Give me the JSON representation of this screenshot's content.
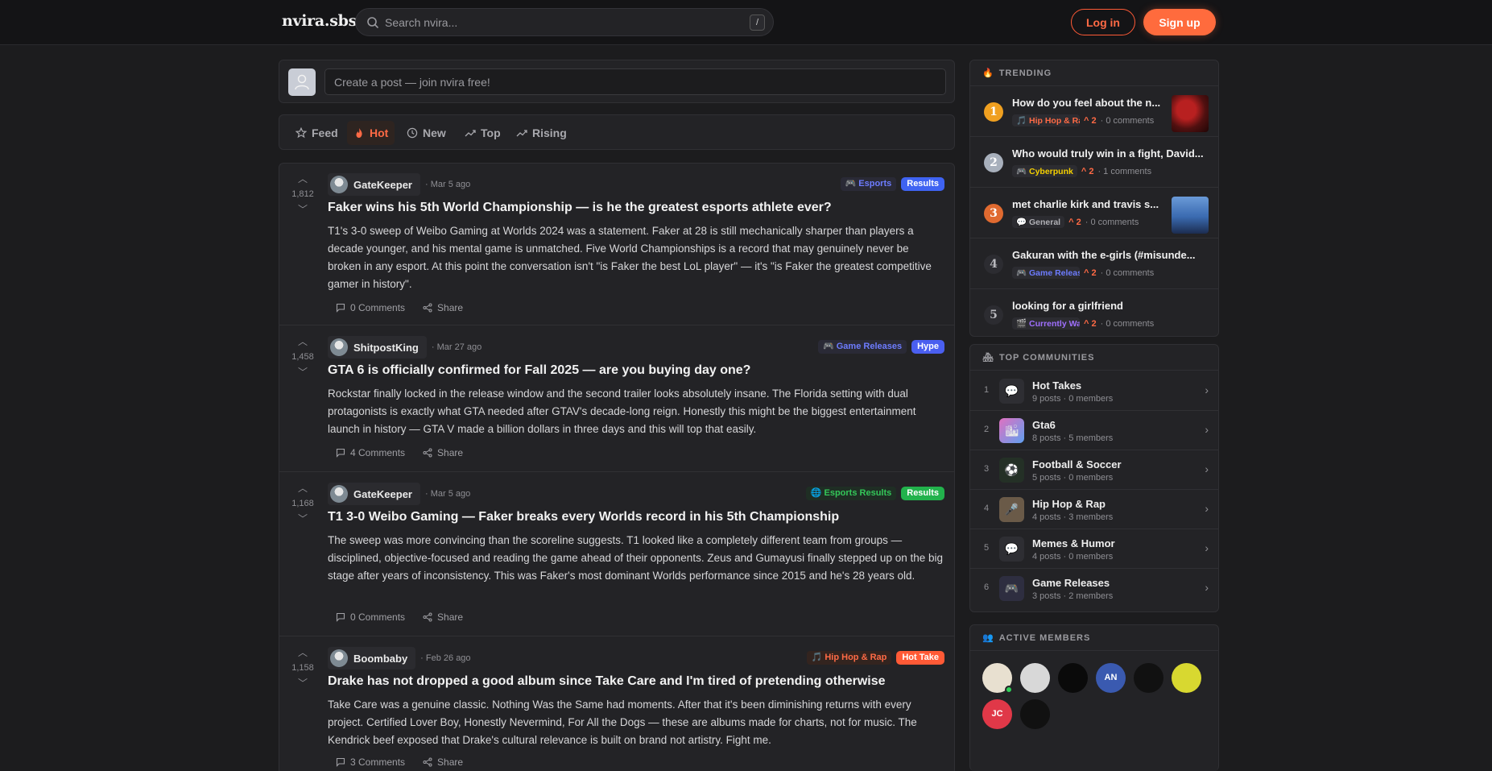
{
  "header": {
    "logo": "nvira.sbs",
    "search_placeholder": "Search nvira...",
    "search_shortcut": "/",
    "login_label": "Log in",
    "signup_label": "Sign up"
  },
  "create_post": {
    "placeholder": "Create a post — join nvira free!"
  },
  "tabs": [
    {
      "label": "Feed",
      "icon": "star-icon",
      "active": false
    },
    {
      "label": "Hot",
      "icon": "flame-icon",
      "active": true
    },
    {
      "label": "New",
      "icon": "clock-icon",
      "active": false
    },
    {
      "label": "Top",
      "icon": "trend-icon",
      "active": false
    },
    {
      "label": "Rising",
      "icon": "rising-icon",
      "active": false
    }
  ],
  "posts": [
    {
      "votes": "1,812",
      "author": "GateKeeper",
      "time": "· Mar 5 ago",
      "category": "🎮 Esports",
      "category_color": "#6d7cff",
      "flair": "Results",
      "flair_color": "#3f63f2",
      "title": "Faker wins his 5th World Championship — is he the greatest esports athlete ever?",
      "body": "T1's 3-0 sweep of Weibo Gaming at Worlds 2024 was a statement. Faker at 28 is still mechanically sharper than players a decade younger, and his mental game is unmatched. Five World Championships is a record that may genuinely never be broken in any esport. At this point the conversation isn't \"is Faker the best LoL player\" — it's \"is Faker the greatest competitive gamer in history\".",
      "comments": "0 Comments",
      "share": "Share"
    },
    {
      "votes": "1,458",
      "author": "ShitpostKing",
      "time": "· Mar 27 ago",
      "category": "🎮 Game Releases",
      "category_color": "#6d7cff",
      "flair": "Hype",
      "flair_color": "#4a5ff0",
      "title": "GTA 6 is officially confirmed for Fall 2025 — are you buying day one?",
      "body": "Rockstar finally locked in the release window and the second trailer looks absolutely insane. The Florida setting with dual protagonists is exactly what GTA needed after GTAV's decade-long reign. Honestly this might be the biggest entertainment launch in history — GTA V made a billion dollars in three days and this will top that easily.",
      "comments": "4 Comments",
      "share": "Share"
    },
    {
      "votes": "1,168",
      "author": "GateKeeper",
      "time": "· Mar 5 ago",
      "category": "🌐 Esports Results",
      "category_color": "#34c759",
      "flair": "Results",
      "flair_color": "#22b24c",
      "title": "T1 3-0 Weibo Gaming — Faker breaks every Worlds record in his 5th Championship",
      "body": "The sweep was more convincing than the scoreline suggests. T1 looked like a completely different team from groups — disciplined, objective-focused and reading the game ahead of their opponents. Zeus and Gumayusi finally stepped up on the big stage after years of inconsistency. This was Faker's most dominant Worlds performance since 2015 and he's 28 years old.",
      "comments": "0 Comments",
      "share": "Share"
    },
    {
      "votes": "1,158",
      "author": "Boombaby",
      "time": "· Feb 26 ago",
      "category": "🎵 Hip Hop & Rap",
      "category_color": "#ff6a45",
      "flair": "Hot Take",
      "flair_color": "#ff5a36",
      "title": "Drake has not dropped a good album since Take Care and I'm tired of pretending otherwise",
      "body": "Take Care was a genuine classic. Nothing Was the Same had moments. After that it's been diminishing returns with every project. Certified Lover Boy, Honestly Nevermind, For All the Dogs — these are albums made for charts, not for music. The Kendrick beef exposed that Drake's cultural relevance is built on brand not artistry. Fight me.",
      "comments": "3 Comments",
      "share": "Share"
    }
  ],
  "trending": {
    "heading": "TRENDING",
    "items": [
      {
        "rank": "1",
        "rank_color": "#f0a020",
        "title": "How do you feel about the n...",
        "category": "🎵 Hip Hop & Ra",
        "category_color": "#ff6a45",
        "score": "^ 2",
        "comments": "· 0 comments",
        "thumb": "red"
      },
      {
        "rank": "2",
        "rank_color": "#a8b0bc",
        "title": "Who would truly win in a fight, David...",
        "category": "🎮 Cyberpunk",
        "category_color": "#f5d000",
        "score": "^ 2",
        "comments": "· 1 comments",
        "thumb": ""
      },
      {
        "rank": "3",
        "rank_color": "#e06a30",
        "title": "met charlie kirk and travis s...",
        "category": "💬 General",
        "category_color": "#b0b0b5",
        "score": "^ 2",
        "comments": "· 0 comments",
        "thumb": "blue"
      },
      {
        "rank": "4",
        "rank_color": "#2c2c31",
        "title": "Gakuran with the e-girls (#misunde...",
        "category": "🎮 Game Releas",
        "category_color": "#6d7cff",
        "score": "^ 2",
        "comments": "· 0 comments",
        "thumb": ""
      },
      {
        "rank": "5",
        "rank_color": "#2c2c31",
        "title": "looking for a girlfriend",
        "category": "🎬 Currently Wa",
        "category_color": "#a070ff",
        "score": "^ 2",
        "comments": "· 0 comments",
        "thumb": ""
      }
    ]
  },
  "communities": {
    "heading": "TOP COMMUNITIES",
    "items": [
      {
        "num": "1",
        "name": "Hot Takes",
        "stats": "9 posts · 0 members",
        "icon": "💬"
      },
      {
        "num": "2",
        "name": "Gta6",
        "stats": "8 posts · 5 members",
        "icon": "🏙"
      },
      {
        "num": "3",
        "name": "Football & Soccer",
        "stats": "5 posts · 0 members",
        "icon": "⚽"
      },
      {
        "num": "4",
        "name": "Hip Hop & Rap",
        "stats": "4 posts · 3 members",
        "icon": "🎤"
      },
      {
        "num": "5",
        "name": "Memes & Humor",
        "stats": "4 posts · 0 members",
        "icon": "💬"
      },
      {
        "num": "6",
        "name": "Game Releases",
        "stats": "3 posts · 2 members",
        "icon": "🎮"
      }
    ]
  },
  "members": {
    "heading": "ACTIVE MEMBERS",
    "items": [
      {
        "initials": "",
        "color": "#e8e0d0"
      },
      {
        "initials": "",
        "color": "#d8d8d8"
      },
      {
        "initials": "",
        "color": "#0a0a0a"
      },
      {
        "initials": "AN",
        "color": "#3a5ab0"
      },
      {
        "initials": "",
        "color": "#111111"
      },
      {
        "initials": "",
        "color": "#d8d830"
      },
      {
        "initials": "JC",
        "color": "#e03848"
      },
      {
        "initials": "",
        "color": "#111111"
      }
    ]
  },
  "colors": {
    "accent": "#ff6b3d",
    "background": "#1c1c1e",
    "panel": "#232326"
  }
}
